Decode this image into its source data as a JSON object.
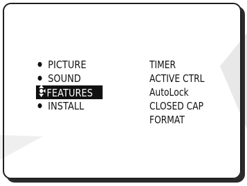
{
  "menu": {
    "items": [
      {
        "label": "PICTURE",
        "selected": false
      },
      {
        "label": "SOUND",
        "selected": false
      },
      {
        "label": "FEATURES",
        "selected": true
      },
      {
        "label": "INSTALL",
        "selected": false
      }
    ]
  },
  "submenu": {
    "items": [
      {
        "label": "TIMER"
      },
      {
        "label": "ACTIVE CTRL"
      },
      {
        "label": "AutoLock"
      },
      {
        "label": "CLOSED CAP"
      },
      {
        "label": "FORMAT"
      }
    ]
  },
  "colors": {
    "background": "#ffffff",
    "text": "#111111",
    "highlight_bg": "#111111",
    "highlight_text": "#ffffff",
    "decor_grey": "#e6e6e6"
  },
  "icons": {
    "bullet": "bullet-dot-icon",
    "selection": "up-down-arrow-icon"
  }
}
